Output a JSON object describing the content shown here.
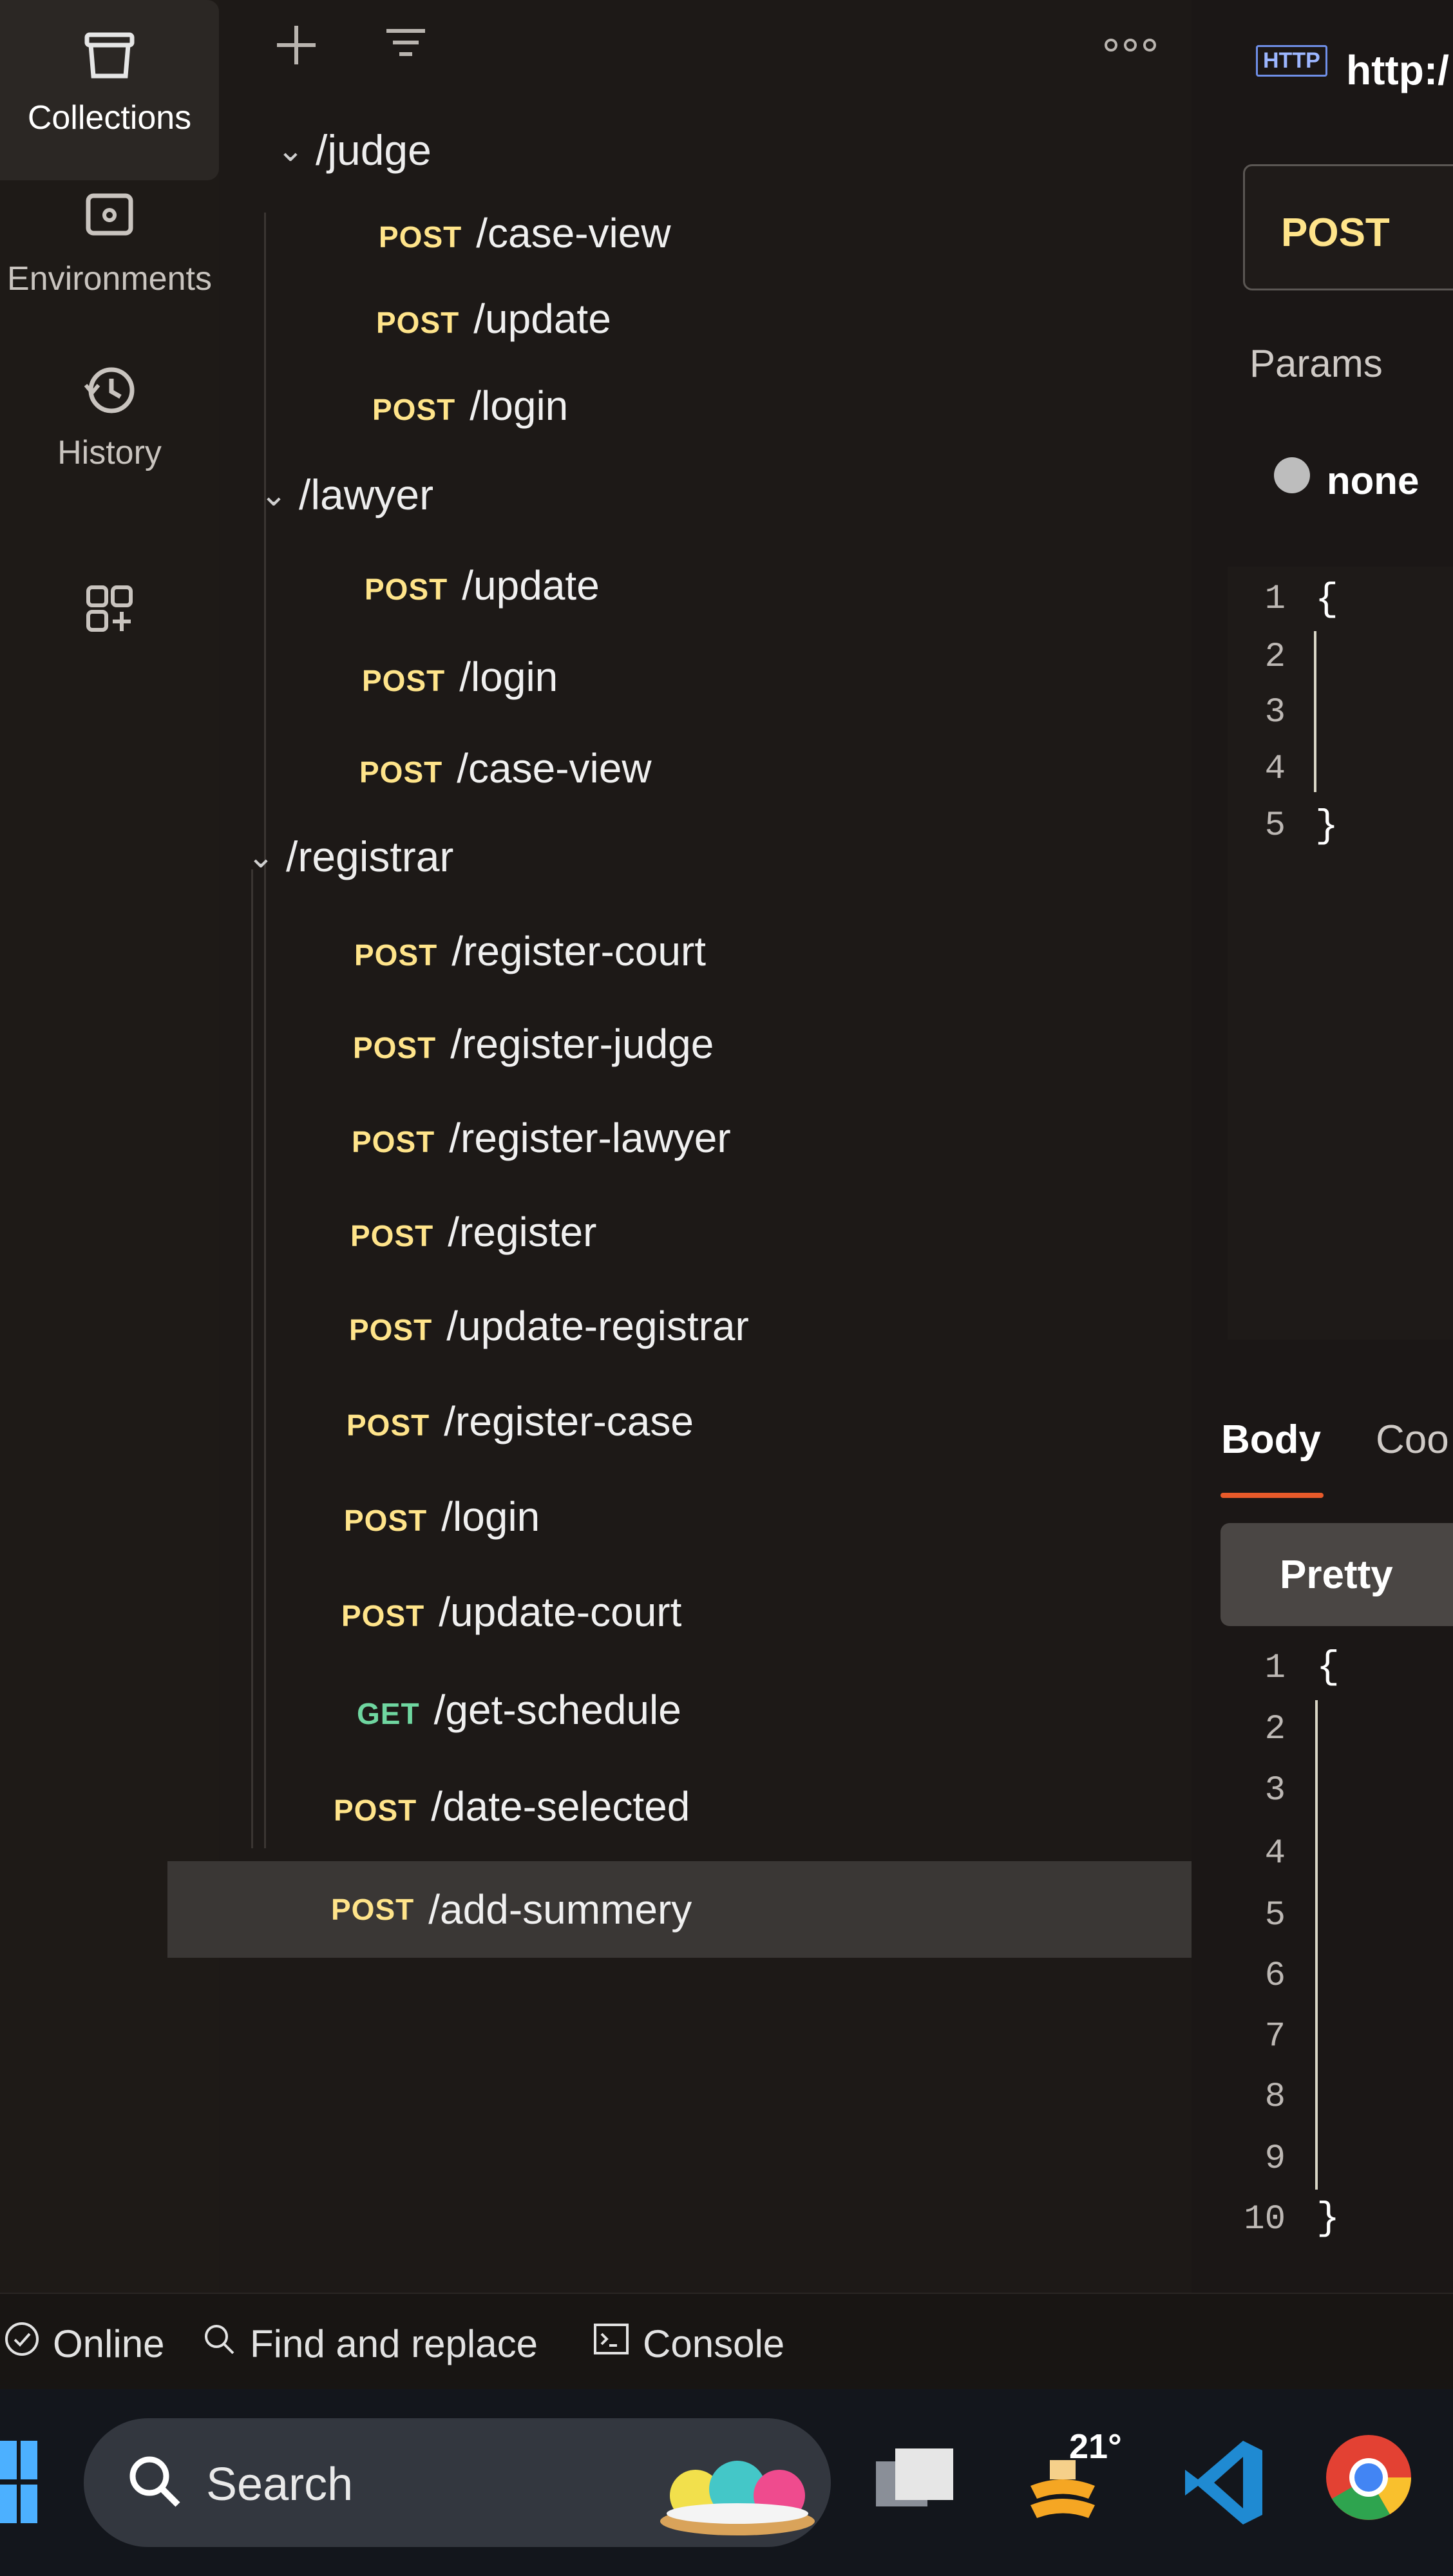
{
  "sidebar": {
    "items": [
      {
        "label": "Collections",
        "icon": "collection-box-icon",
        "active": true
      },
      {
        "label": "Environments",
        "icon": "environment-icon",
        "active": false
      },
      {
        "label": "History",
        "icon": "history-icon",
        "active": false
      },
      {
        "label": "",
        "icon": "add-workspace-icon",
        "active": false
      }
    ]
  },
  "collections": {
    "toolbar_icons": [
      "plus-icon",
      "filter-icon",
      "more-icon"
    ],
    "folders": [
      {
        "name": "/judge",
        "requests": [
          {
            "method": "POST",
            "path": "/case-view"
          },
          {
            "method": "POST",
            "path": "/update"
          },
          {
            "method": "POST",
            "path": "/login"
          }
        ]
      },
      {
        "name": "/lawyer",
        "requests": [
          {
            "method": "POST",
            "path": "/update"
          },
          {
            "method": "POST",
            "path": "/login"
          },
          {
            "method": "POST",
            "path": "/case-view"
          }
        ]
      },
      {
        "name": "/registrar",
        "requests": [
          {
            "method": "POST",
            "path": "/register-court"
          },
          {
            "method": "POST",
            "path": "/register-judge"
          },
          {
            "method": "POST",
            "path": "/register-lawyer"
          },
          {
            "method": "POST",
            "path": "/register"
          },
          {
            "method": "POST",
            "path": "/update-registrar"
          },
          {
            "method": "POST",
            "path": "/register-case"
          },
          {
            "method": "POST",
            "path": "/login"
          },
          {
            "method": "POST",
            "path": "/update-court"
          },
          {
            "method": "GET",
            "path": "/get-schedule"
          },
          {
            "method": "POST",
            "path": "/date-selected"
          },
          {
            "method": "POST",
            "path": "/add-summery",
            "selected": true
          }
        ]
      }
    ]
  },
  "request": {
    "protocol_badge": "HTTP",
    "url": "http:/",
    "method": "POST",
    "params_tab": "Params",
    "body_type": "none",
    "body_lines": [
      "1",
      "2",
      "3",
      "4",
      "5"
    ],
    "open_brace": "{",
    "close_brace": "}"
  },
  "response": {
    "tabs": [
      "Body",
      "Coo"
    ],
    "active_tab": "Body",
    "view_mode": "Pretty",
    "lines": [
      "1",
      "2",
      "3",
      "4",
      "5",
      "6",
      "7",
      "8",
      "9",
      "10"
    ],
    "open_brace": "{",
    "close_brace": "}"
  },
  "statusbar": {
    "online": "Online",
    "find_replace": "Find and replace",
    "console": "Console"
  },
  "taskbar": {
    "search_placeholder": "Search",
    "weather_temp": "21°",
    "icons": [
      "windows-start-icon",
      "search-icon",
      "widgets-icon",
      "task-view-icon",
      "weather-icon",
      "vscode-icon",
      "chrome-icon"
    ]
  },
  "colors": {
    "post": "#ffe48a",
    "get": "#6fd6a0",
    "accent_underline": "#e85a2a"
  }
}
